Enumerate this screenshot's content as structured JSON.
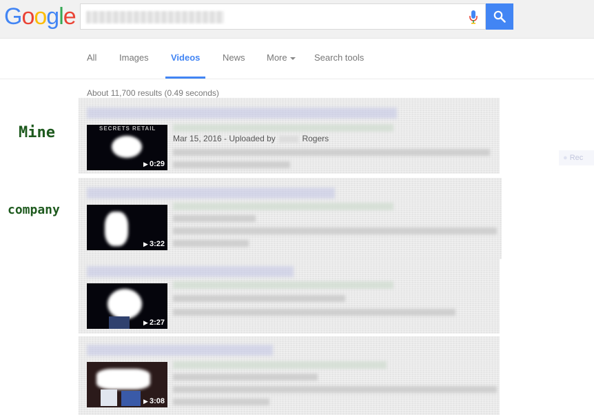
{
  "logo": {
    "letters": [
      "G",
      "o",
      "o",
      "g",
      "l",
      "e"
    ]
  },
  "colors": {
    "blue": "#4285f4",
    "red": "#ea4335",
    "yellow": "#fbbc05",
    "green": "#34a853",
    "annot": "#1e5a1e"
  },
  "search": {
    "button_icon": "search-icon",
    "mic_icon": "microphone-icon"
  },
  "tabs": [
    {
      "label": "All"
    },
    {
      "label": "Images"
    },
    {
      "label": "Videos",
      "active": true
    },
    {
      "label": "News"
    },
    {
      "label": "More"
    },
    {
      "label": "Search tools"
    }
  ],
  "stats": "About 11,700 results (0.49 seconds)",
  "annotations": {
    "mine": "Mine",
    "company": "company"
  },
  "results": [
    {
      "duration": "0:29",
      "meta_prefix": "Mar 15, 2016 - Uploaded by",
      "meta_suffix": "Rogers",
      "thumb_text": "SECRETS RETAIL"
    },
    {
      "duration": "3:22"
    },
    {
      "duration": "2:27"
    },
    {
      "duration": "3:08"
    }
  ],
  "side_chip": "Rec"
}
